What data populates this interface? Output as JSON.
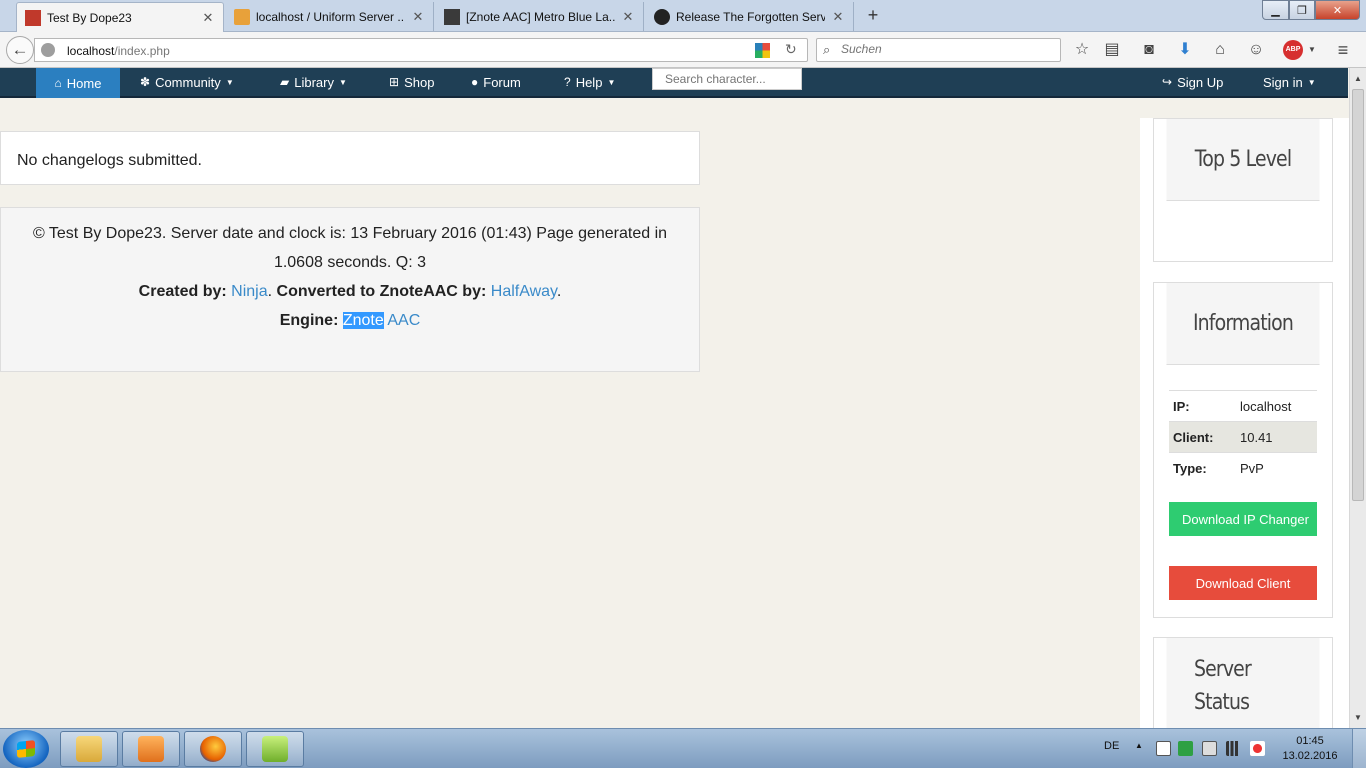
{
  "browser": {
    "tabs": [
      {
        "title": "Test By Dope23",
        "favicon_color": "#c0392b",
        "active": true
      },
      {
        "title": "localhost / Uniform Server ...",
        "favicon_color": "#e8a13a",
        "active": false
      },
      {
        "title": "[Znote AAC] Metro Blue La...",
        "favicon_color": "#3a3a3a",
        "active": false
      },
      {
        "title": "Release The Forgotten Serv...",
        "favicon_color": "#222222",
        "active": false
      }
    ],
    "new_tab_glyph": "+",
    "url_host": "localhost",
    "url_path": "/index.php",
    "search_placeholder": "Suchen"
  },
  "site_nav": {
    "home": "Home",
    "community": "Community",
    "library": "Library",
    "shop": "Shop",
    "forum": "Forum",
    "help": "Help",
    "search_placeholder": "Search character...",
    "sign_up": "Sign Up",
    "sign_in": "Sign in"
  },
  "content": {
    "changelog_text": "No changelogs submitted.",
    "footer": {
      "line1": "© Test By Dope23. Server date and clock is: 13 February 2016 (01:43) Page generated in 1.0608 seconds. Q: 3",
      "created_by_label": "Created by:",
      "created_by_link": "Ninja",
      "converted_label": "Converted to ZnoteAAC by:",
      "converted_link": "HalfAway",
      "engine_label": "Engine:",
      "engine_link_part1": "Znote",
      "engine_link_part2": "AAC",
      "period": "."
    }
  },
  "sidebar": {
    "top5_title": "Top 5 Level",
    "info_title": "Information",
    "info_rows": [
      {
        "label": "IP:",
        "value": "localhost"
      },
      {
        "label": "Client:",
        "value": "10.41"
      },
      {
        "label": "Type:",
        "value": "PvP"
      }
    ],
    "download_ip_label": "Download IP Changer",
    "download_client_label": "Download Client",
    "status_title_line1": "Server",
    "status_title_line2": "Status"
  },
  "taskbar": {
    "lang": "DE",
    "time": "01:45",
    "date": "13.02.2016"
  },
  "colors": {
    "nav_bg": "#1f3f55",
    "nav_active": "#2b7fc0",
    "link": "#3a8ac9",
    "btn_green": "#2ecc71",
    "btn_red": "#e74c3c"
  }
}
